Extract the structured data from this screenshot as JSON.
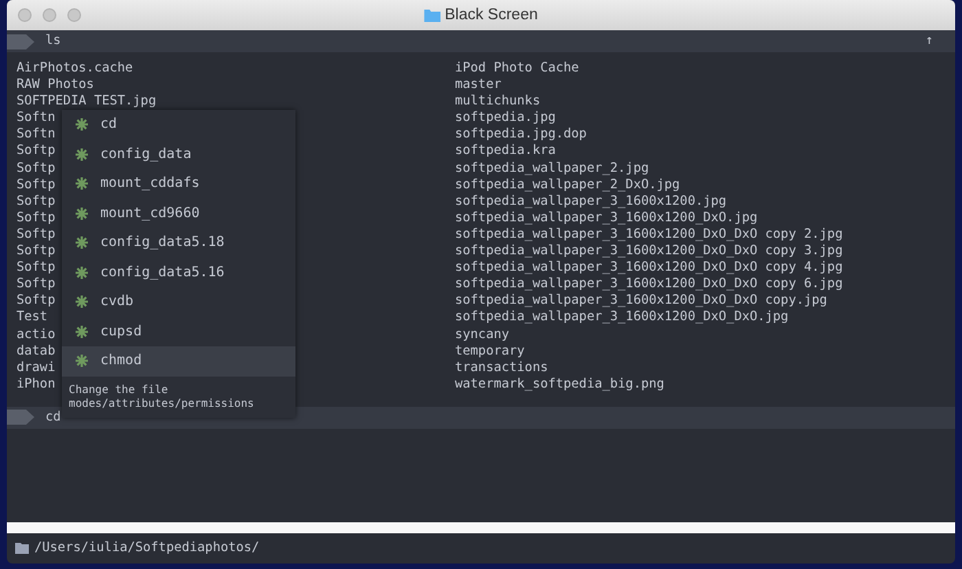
{
  "window": {
    "title": "Black Screen"
  },
  "prompts": [
    {
      "command": "ls",
      "scroll_up": "↑"
    },
    {
      "command": "cd"
    }
  ],
  "output": {
    "column_1": [
      "AirPhotos.cache",
      "RAW Photos",
      "SOFTPEDIA TEST.jpg",
      "Softn",
      "Softn",
      "Softp",
      "Softp",
      "Softp",
      "Softp",
      "Softp",
      "Softp",
      "Softp",
      "Softp",
      "Softp",
      "Softp",
      "Test",
      "actio",
      "datab",
      "drawi",
      "iPhon"
    ],
    "column_2": [
      "iPod Photo Cache",
      "master",
      "multichunks",
      "softpedia.jpg",
      "softpedia.jpg.dop",
      "softpedia.kra",
      "softpedia_wallpaper_2.jpg",
      "softpedia_wallpaper_2_DxO.jpg",
      "softpedia_wallpaper_3_1600x1200.jpg",
      "softpedia_wallpaper_3_1600x1200_DxO.jpg",
      "softpedia_wallpaper_3_1600x1200_DxO_DxO copy 2.jpg",
      "softpedia_wallpaper_3_1600x1200_DxO_DxO copy 3.jpg",
      "softpedia_wallpaper_3_1600x1200_DxO_DxO copy 4.jpg",
      "softpedia_wallpaper_3_1600x1200_DxO_DxO copy 6.jpg",
      "softpedia_wallpaper_3_1600x1200_DxO_DxO copy.jpg",
      "softpedia_wallpaper_3_1600x1200_DxO_DxO.jpg",
      "syncany",
      "temporary",
      "transactions",
      "watermark_softpedia_big.png"
    ]
  },
  "autocomplete": {
    "items": [
      {
        "label": "cd",
        "selected": false
      },
      {
        "label": "config_data",
        "selected": false
      },
      {
        "label": "mount_cddafs",
        "selected": false
      },
      {
        "label": "mount_cd9660",
        "selected": false
      },
      {
        "label": "config_data5.18",
        "selected": false
      },
      {
        "label": "config_data5.16",
        "selected": false
      },
      {
        "label": "cvdb",
        "selected": false
      },
      {
        "label": "cupsd",
        "selected": false
      },
      {
        "label": "chmod",
        "selected": true
      }
    ],
    "description": "Change the file modes/attributes/permissions"
  },
  "status_bar": {
    "path": "/Users/iulia/Softpediaphotos/"
  }
}
